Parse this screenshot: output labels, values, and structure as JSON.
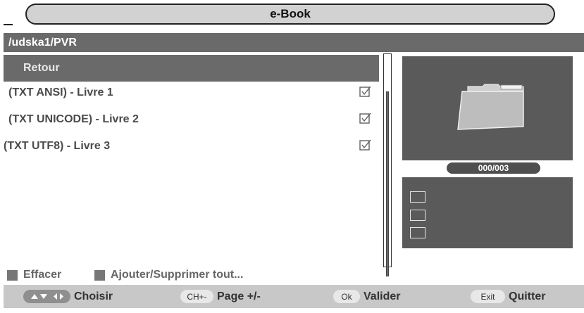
{
  "window": {
    "title": "e-Book"
  },
  "path": "/udska1/PVR",
  "list": {
    "back_label": "Retour",
    "items": [
      {
        "label": "(TXT ANSI) - Livre 1",
        "checked": true,
        "icon": "checkbox-checked-icon"
      },
      {
        "label": "(TXT UNICODE) - Livre 2",
        "checked": true,
        "icon": "checkbox-checked-icon"
      },
      {
        "label": "(TXT UTF8) - Livre 3",
        "checked": true,
        "icon": "checkbox-checked-icon"
      }
    ]
  },
  "preview": {
    "icon": "folder-icon",
    "counter": "000/003"
  },
  "actions": {
    "delete_label": "Effacer",
    "toggle_all_label": "Ajouter/Supprimer tout..."
  },
  "footer": {
    "choose": {
      "key_icon": "arrow-keys-icon",
      "label": "Choisir"
    },
    "page": {
      "key": "CH+-",
      "label": "Page +/-"
    },
    "ok": {
      "key": "Ok",
      "label": "Valider"
    },
    "exit": {
      "key": "Exit",
      "label": "Quitter"
    }
  },
  "colors": {
    "dark_bar": "#6a6a6a",
    "panel": "#5a5a5a",
    "footer": "#c8c8c8",
    "title": "#d2d2d2"
  }
}
